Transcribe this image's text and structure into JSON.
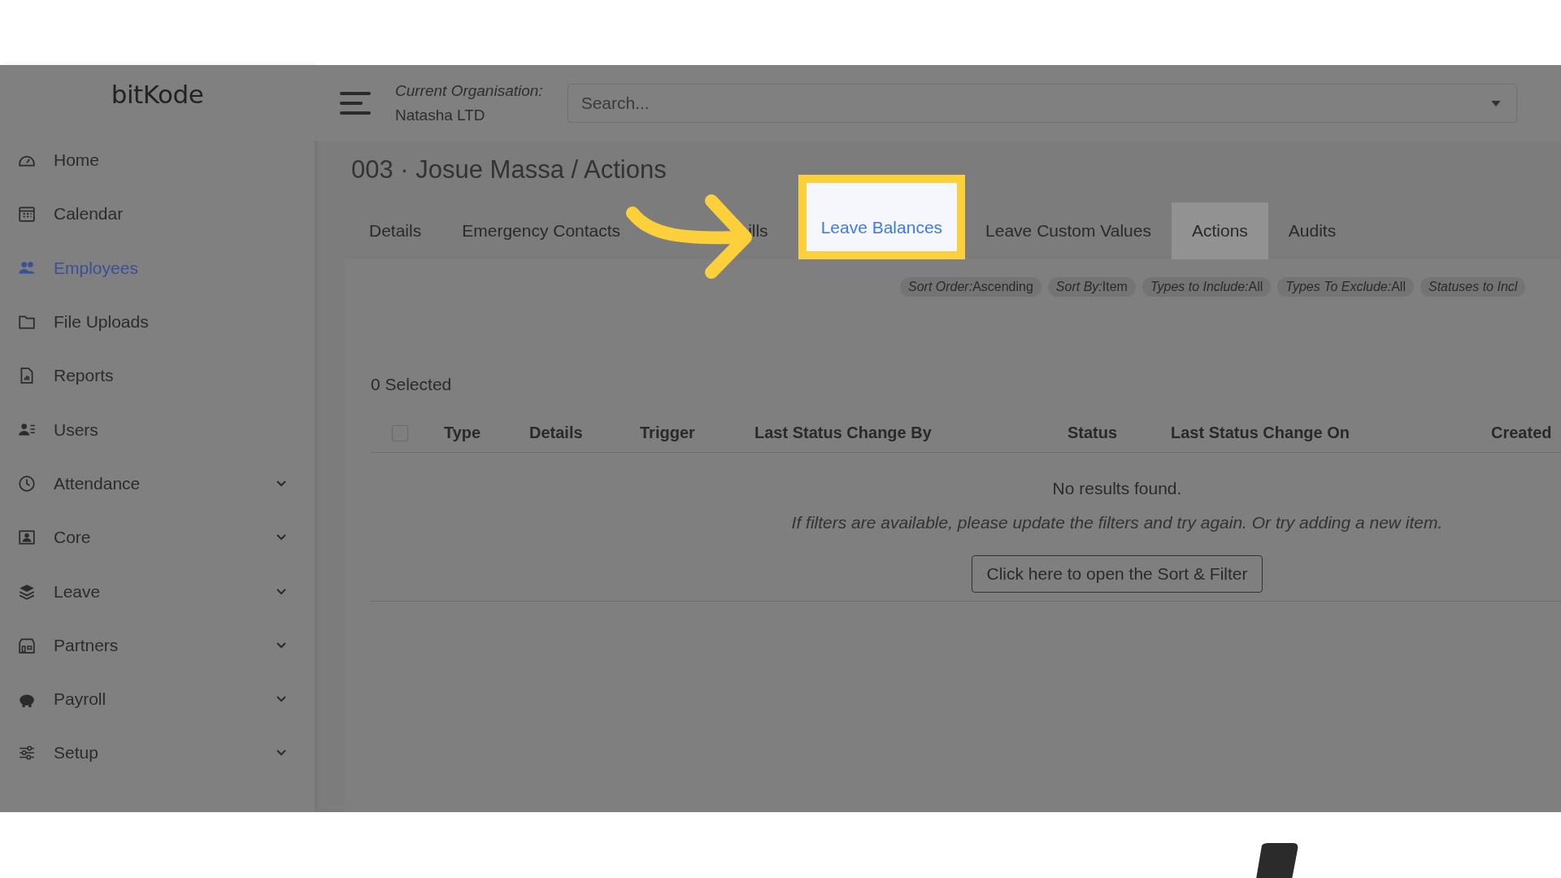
{
  "sidebar": {
    "logo": "bitKode",
    "items": [
      {
        "label": "Home",
        "selected": false,
        "expandable": false
      },
      {
        "label": "Calendar",
        "selected": false,
        "expandable": false
      },
      {
        "label": "Employees",
        "selected": true,
        "expandable": false
      },
      {
        "label": "File Uploads",
        "selected": false,
        "expandable": false
      },
      {
        "label": "Reports",
        "selected": false,
        "expandable": false
      },
      {
        "label": "Users",
        "selected": false,
        "expandable": false
      },
      {
        "label": "Attendance",
        "selected": false,
        "expandable": true
      },
      {
        "label": "Core",
        "selected": false,
        "expandable": true
      },
      {
        "label": "Leave",
        "selected": false,
        "expandable": true
      },
      {
        "label": "Partners",
        "selected": false,
        "expandable": true
      },
      {
        "label": "Payroll",
        "selected": false,
        "expandable": true
      },
      {
        "label": "Setup",
        "selected": false,
        "expandable": true
      }
    ]
  },
  "header": {
    "organisation_label": "Current Organisation:",
    "organisation": "Natasha LTD",
    "search": {
      "placeholder": "Search..."
    }
  },
  "page_title": "003 · Josue Massa / Actions",
  "tabs": [
    {
      "label": "Details",
      "selected": false,
      "highlighted": false
    },
    {
      "label": "Emergency Contacts",
      "selected": false,
      "highlighted": false
    },
    {
      "label": "ills",
      "selected": false,
      "highlighted": false
    },
    {
      "label": "Leave Balances",
      "selected": false,
      "highlighted": true
    },
    {
      "label": "Leave Custom Values",
      "selected": false,
      "highlighted": false
    },
    {
      "label": "Actions",
      "selected": true,
      "highlighted": false
    },
    {
      "label": "Audits",
      "selected": false,
      "highlighted": false
    }
  ],
  "filter_chips": [
    {
      "label": "Sort Order:",
      "value": "Ascending"
    },
    {
      "label": "Sort By:",
      "value": "Item"
    },
    {
      "label": "Types to Include:",
      "value": "All"
    },
    {
      "label": "Types To Exclude:",
      "value": "All"
    },
    {
      "label": "Statuses to Incl"
    }
  ],
  "selected_count": "0 Selected",
  "table": {
    "select_all_checked": false,
    "columns": [
      "Type",
      "Details",
      "Trigger",
      "Last Status Change By",
      "Status",
      "Last Status Change On",
      "Created"
    ],
    "empty_title": "No results found.",
    "empty_hint": "If filters are available, please update the filters and try again. Or try adding a new item.",
    "empty_button": "Click here to open the Sort & Filter"
  }
}
